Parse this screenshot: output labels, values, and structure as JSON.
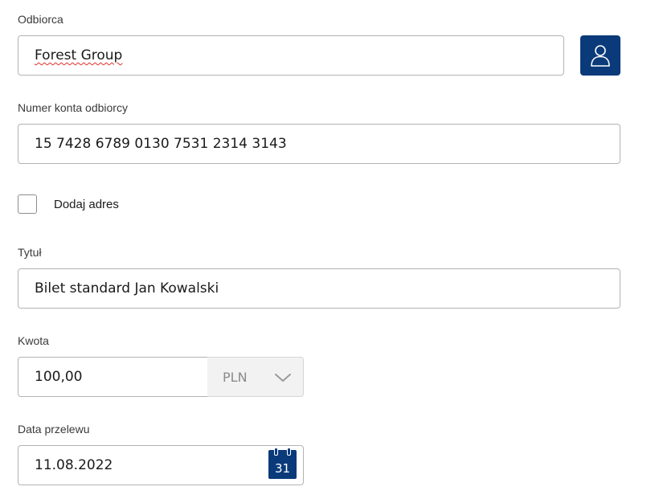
{
  "recipient": {
    "label": "Odbiorca",
    "value": "Forest Group"
  },
  "account": {
    "label": "Numer konta odbiorcy",
    "value": "15 7428 6789 0130 7531 2314 3143"
  },
  "address": {
    "label": "Dodaj adres",
    "checked": false
  },
  "title": {
    "label": "Tytuł",
    "value": "Bilet standard Jan Kowalski"
  },
  "amount": {
    "label": "Kwota",
    "value": "100,00",
    "currency": "PLN"
  },
  "transfer_date": {
    "label": "Data przelewu",
    "value": "11.08.2022",
    "calendar_day": "31"
  },
  "icons": {
    "contact": "user-icon",
    "currency_dropdown": "chevron-down-icon",
    "calendar": "calendar-icon"
  },
  "colors": {
    "accent": "#0a3a7a",
    "border": "#b3b3b3",
    "disabled_bg": "#f2f2f2",
    "spellcheck": "#e0302a"
  }
}
